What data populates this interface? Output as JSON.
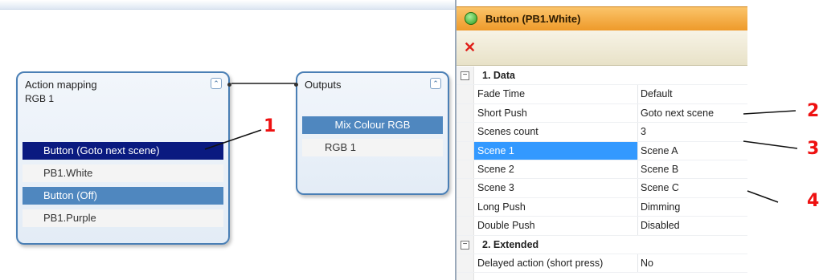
{
  "canvas": {
    "action_node": {
      "title": "Action mapping",
      "subtitle": "RGB 1",
      "items": [
        {
          "label": "Button (Goto next scene)",
          "style": "dark"
        },
        {
          "label": "PB1.White",
          "style": "plain"
        },
        {
          "label": "Button (Off)",
          "style": "mid"
        },
        {
          "label": "PB1.Purple",
          "style": "plain"
        }
      ]
    },
    "outputs_node": {
      "title": "Outputs",
      "items": [
        {
          "label": "Mix Colour RGB",
          "style": "mid"
        },
        {
          "label": "RGB 1",
          "style": "plain"
        }
      ]
    },
    "collapse_glyph": "⌃"
  },
  "panel": {
    "title": "Button (PB1.White)",
    "delete_glyph": "✕",
    "categories": [
      {
        "label": "1. Data",
        "expander": "−",
        "rows": [
          {
            "key": "Fade Time",
            "value": "Default"
          },
          {
            "key": "Short Push",
            "value": "Goto next scene"
          },
          {
            "key": "Scenes count",
            "value": "3"
          },
          {
            "key": "Scene 1",
            "value": "Scene A",
            "selected": true
          },
          {
            "key": "Scene 2",
            "value": "Scene B"
          },
          {
            "key": "Scene 3",
            "value": "Scene C"
          },
          {
            "key": "Long Push",
            "value": "Dimming"
          },
          {
            "key": "Double Push",
            "value": "Disabled"
          }
        ]
      },
      {
        "label": "2. Extended",
        "expander": "−",
        "rows": [
          {
            "key": "Delayed action (short press)",
            "value": "No"
          }
        ]
      }
    ]
  },
  "annotations": {
    "callouts": [
      "1",
      "2",
      "3",
      "4"
    ],
    "color": "#ee1111"
  },
  "colors": {
    "node_border": "#4a7fb5",
    "selected_dark": "#0a1a80",
    "selected_mid": "#4f87bf",
    "panel_header": "#ee9a2a",
    "grid_selection": "#3399ff"
  }
}
